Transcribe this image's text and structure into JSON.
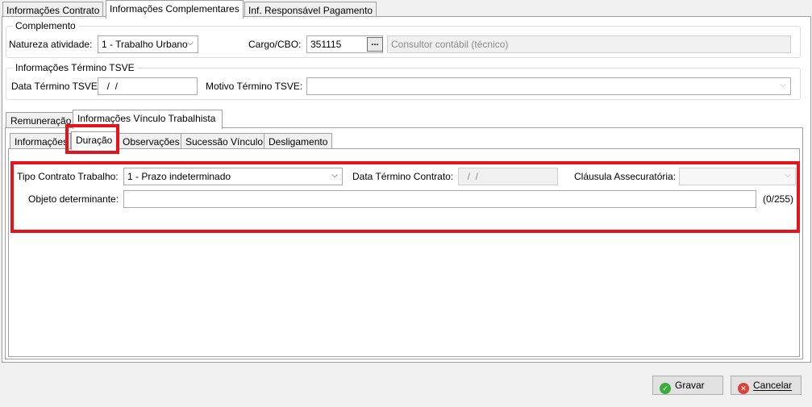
{
  "top_tabs": [
    "Informações Contrato",
    "Informações Complementares",
    "Inf. Responsável Pagamento"
  ],
  "complemento": {
    "title": "Complemento",
    "natureza_label": "Natureza atividade:",
    "natureza_value": "1 - Trabalho Urbano",
    "cargo_label": "Cargo/CBO:",
    "cargo_code": "351115",
    "cargo_desc": "Consultor contábil (técnico)",
    "lookup_button": "...",
    "select_icon": "chevron-down-icon"
  },
  "termino_tsve": {
    "title": "Informações Término TSVE",
    "data_label": "Data Término TSVE:",
    "data_value": "  /  /",
    "motivo_label": "Motivo Término TSVE:",
    "motivo_value": ""
  },
  "mid_tabs": [
    "Remuneração",
    "Informações Vínculo Trabalhista"
  ],
  "sub_tabs": [
    "Informações",
    "Duração",
    "Observações",
    "Sucessão Vínculo",
    "Desligamento"
  ],
  "duracao": {
    "tipo_label": "Tipo Contrato Trabalho:",
    "tipo_value": "1 - Prazo indeterminado",
    "data_label": "Data Término Contrato:",
    "data_value": "  /  /",
    "clausula_label": "Cláusula Assecuratória:",
    "clausula_value": "",
    "objeto_label": "Objeto determinante:",
    "objeto_value": "",
    "objeto_counter": "(0/255)"
  },
  "buttons": {
    "save": "Gravar",
    "cancel": "Cancelar",
    "save_icon": "check-icon",
    "cancel_icon": "cancel-icon"
  },
  "colors": {
    "highlight": "#e3141b",
    "save_icon": "#3bab3b",
    "cancel_icon": "#d9443a"
  }
}
